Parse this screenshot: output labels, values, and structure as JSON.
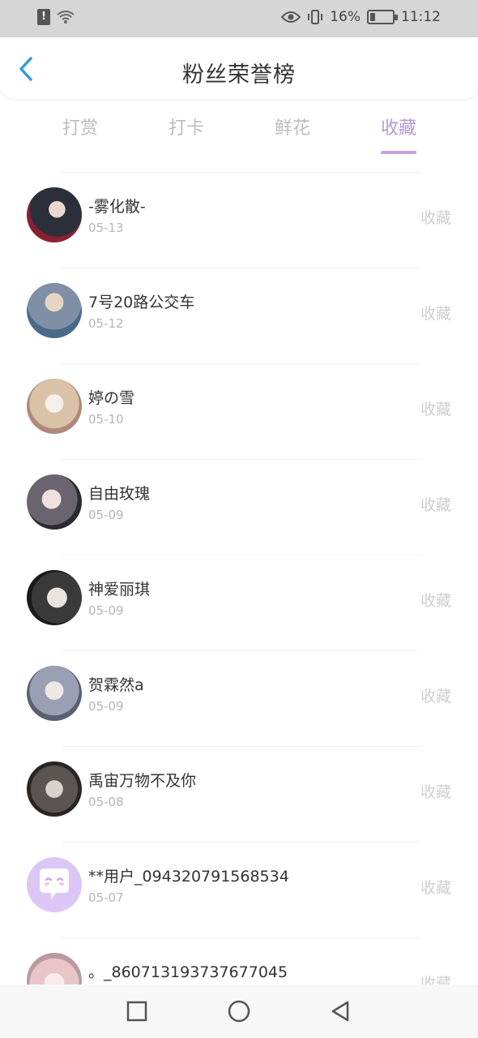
{
  "status_bar": {
    "battery": "16%",
    "time": "11:12",
    "sim_alert": "!"
  },
  "header": {
    "title": "粉丝荣誉榜"
  },
  "tabs": [
    {
      "label": "打赏",
      "active": false
    },
    {
      "label": "打卡",
      "active": false
    },
    {
      "label": "鲜花",
      "active": false
    },
    {
      "label": "收藏",
      "active": true
    }
  ],
  "list": [
    {
      "name": "-雾化散-",
      "date": "05-13",
      "action": "收藏",
      "avatar_color": "#2b2f3a"
    },
    {
      "name": "7号20路公交车",
      "date": "05-12",
      "action": "收藏",
      "avatar_color": "#7f8fa6"
    },
    {
      "name": "婷の雪",
      "date": "05-10",
      "action": "收藏",
      "avatar_color": "#d9c2a8"
    },
    {
      "name": "自由玫瑰",
      "date": "05-09",
      "action": "收藏",
      "avatar_color": "#6a6470"
    },
    {
      "name": "神爱丽琪",
      "date": "05-09",
      "action": "收藏",
      "avatar_color": "#3a3a3a"
    },
    {
      "name": "贺霖然a",
      "date": "05-09",
      "action": "收藏",
      "avatar_color": "#9aa0b3"
    },
    {
      "name": "禹宙万物不及你",
      "date": "05-08",
      "action": "收藏",
      "avatar_color": "#5a5553"
    },
    {
      "name": "**用户_094320791568534",
      "date": "05-07",
      "action": "收藏",
      "avatar_color": "#d9c3f5",
      "default_avatar": true
    },
    {
      "name": "。_860713193737677045",
      "date": "",
      "action": "收藏",
      "avatar_color": "#e8c6c8"
    }
  ],
  "colors": {
    "accent": "#b698d8",
    "back": "#2f9be0"
  }
}
